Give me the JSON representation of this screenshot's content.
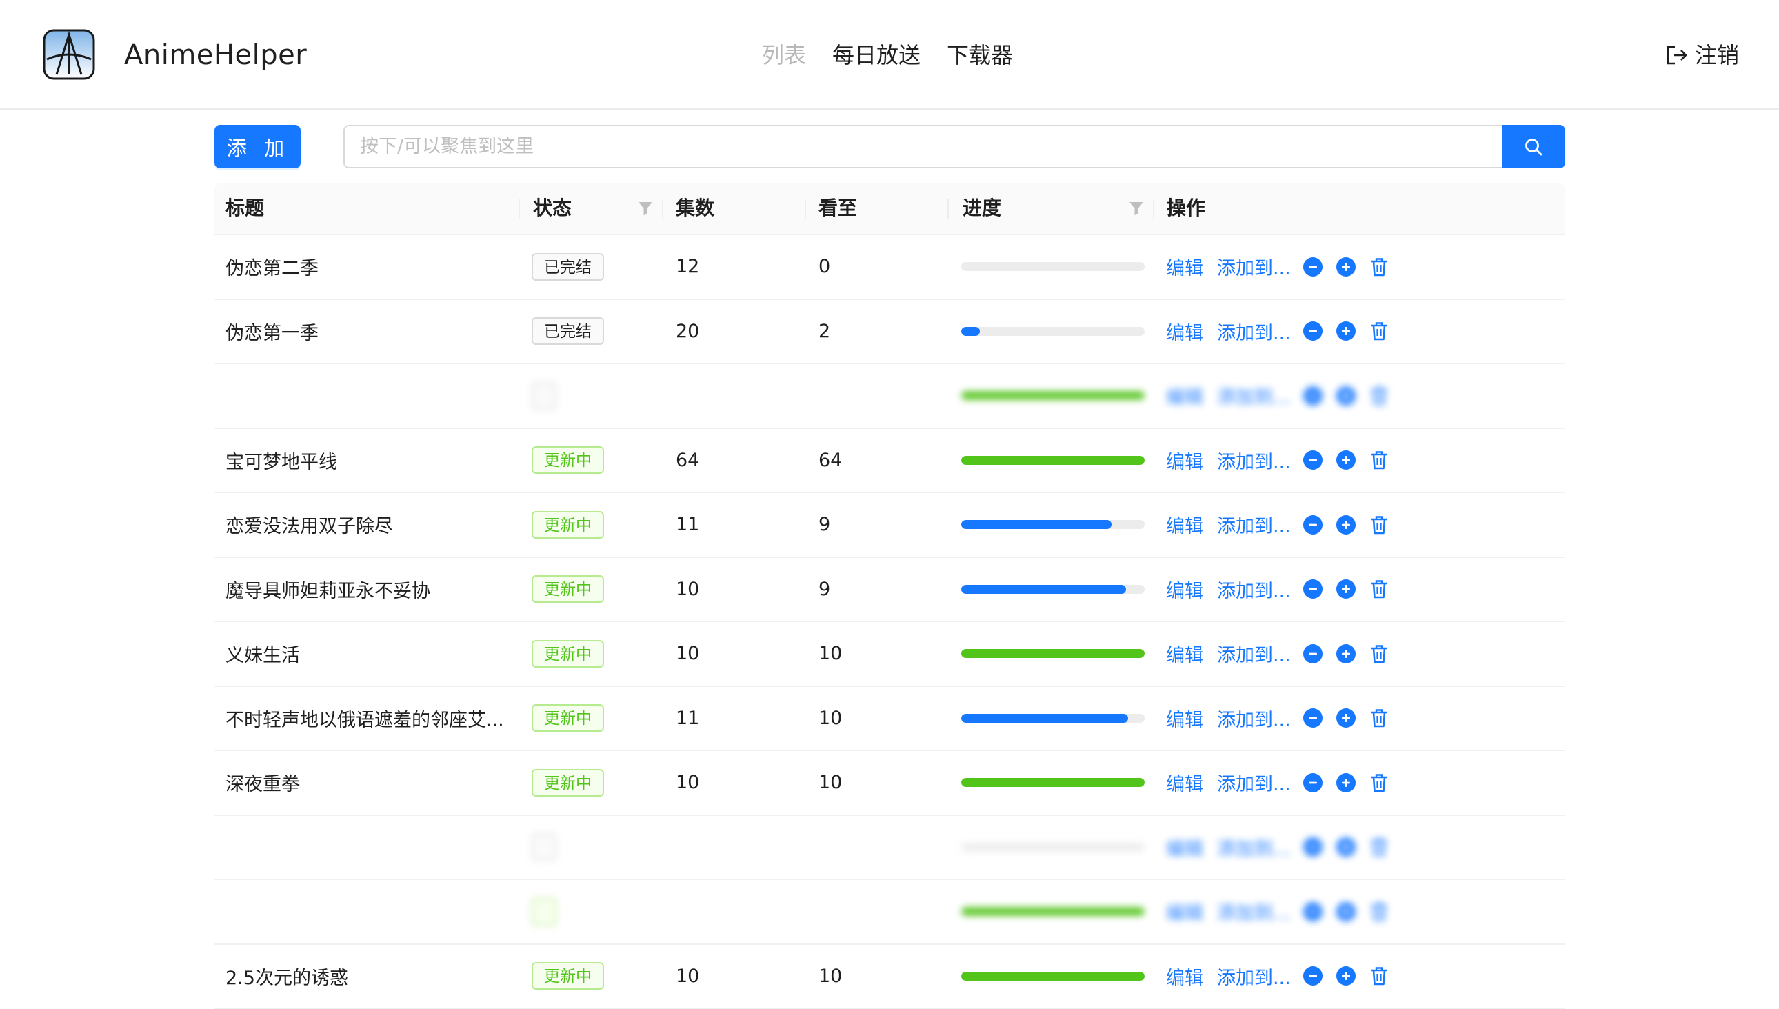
{
  "header": {
    "app_name": "AnimeHelper",
    "nav": [
      {
        "label": "列表",
        "active": true
      },
      {
        "label": "每日放送",
        "active": false
      },
      {
        "label": "下载器",
        "active": false
      }
    ],
    "logout_label": "注销"
  },
  "toolbar": {
    "add_label": "添 加",
    "search_placeholder": "按下/可以聚焦到这里"
  },
  "table": {
    "columns": [
      "标题",
      "状态",
      "集数",
      "看至",
      "进度",
      "操作"
    ],
    "actions": {
      "edit": "编辑",
      "add_to": "添加到..."
    },
    "colors": {
      "complete_green": "#52c41a",
      "in_progress_blue": "#1677ff"
    },
    "rows": [
      {
        "title": "伪恋第二季",
        "status": "已完结",
        "status_type": "done",
        "episodes": "12",
        "watched": "0",
        "progress": 0.0,
        "bar_color": "#1677ff",
        "blurred": false
      },
      {
        "title": "伪恋第一季",
        "status": "已完结",
        "status_type": "done",
        "episodes": "20",
        "watched": "2",
        "progress": 0.1,
        "bar_color": "#1677ff",
        "blurred": false
      },
      {
        "title": "",
        "status": "",
        "status_type": "done",
        "episodes": "",
        "watched": "",
        "progress": 1.0,
        "bar_color": "#52c41a",
        "blurred": true
      },
      {
        "title": "宝可梦地平线",
        "status": "更新中",
        "status_type": "ongoing",
        "episodes": "64",
        "watched": "64",
        "progress": 1.0,
        "bar_color": "#52c41a",
        "blurred": false
      },
      {
        "title": "恋爱没法用双子除尽",
        "status": "更新中",
        "status_type": "ongoing",
        "episodes": "11",
        "watched": "9",
        "progress": 0.82,
        "bar_color": "#1677ff",
        "blurred": false
      },
      {
        "title": "魔导具师妲莉亚永不妥协",
        "status": "更新中",
        "status_type": "ongoing",
        "episodes": "10",
        "watched": "9",
        "progress": 0.9,
        "bar_color": "#1677ff",
        "blurred": false
      },
      {
        "title": "义妹生活",
        "status": "更新中",
        "status_type": "ongoing",
        "episodes": "10",
        "watched": "10",
        "progress": 1.0,
        "bar_color": "#52c41a",
        "blurred": false
      },
      {
        "title": "不时轻声地以俄语遮羞的邻座艾...",
        "status": "更新中",
        "status_type": "ongoing",
        "episodes": "11",
        "watched": "10",
        "progress": 0.91,
        "bar_color": "#1677ff",
        "blurred": false
      },
      {
        "title": "深夜重拳",
        "status": "更新中",
        "status_type": "ongoing",
        "episodes": "10",
        "watched": "10",
        "progress": 1.0,
        "bar_color": "#52c41a",
        "blurred": false
      },
      {
        "title": "",
        "status": "",
        "status_type": "done",
        "episodes": "",
        "watched": "",
        "progress": 0.0,
        "bar_color": "#1677ff",
        "blurred": true
      },
      {
        "title": "",
        "status": "",
        "status_type": "ongoing",
        "episodes": "",
        "watched": "",
        "progress": 1.0,
        "bar_color": "#52c41a",
        "blurred": true
      },
      {
        "title": "2.5次元的诱惑",
        "status": "更新中",
        "status_type": "ongoing",
        "episodes": "10",
        "watched": "10",
        "progress": 1.0,
        "bar_color": "#52c41a",
        "blurred": false
      }
    ]
  }
}
